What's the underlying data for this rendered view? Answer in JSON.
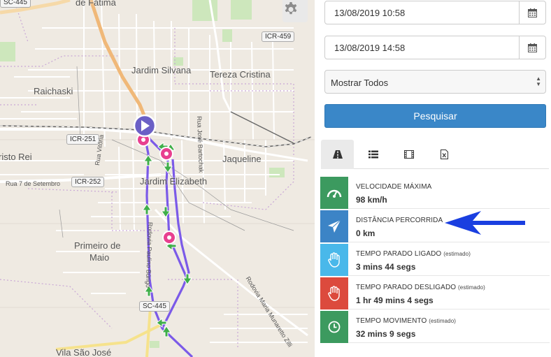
{
  "map": {
    "labels": {
      "fatima": "de Fátima",
      "jardim_silvana": "Jardim Silvana",
      "tereza_cristina": "Tereza Cristina",
      "raichaski": "Raichaski",
      "cristo_rei": "risto Rei",
      "jaqueline": "Jaqueline",
      "jardim_elizabeth": "Jardim Elizabeth",
      "primeiro_de_maio": "Primeiro de",
      "primeiro_de_maio_2": "Maio",
      "vila_sao_jose": "Vila São José"
    },
    "shields": {
      "sc445_top": "SC-445",
      "icr459": "ICR-459",
      "icr251": "ICR-251",
      "icr252": "ICR-252",
      "sc445_bottom": "SC-445"
    },
    "road_names": {
      "rua_7_setembro": "Rua 7 de Setembro",
      "rua_vitoria": "Rua Vitória",
      "rua_jose_bartochak": "Rua José Bartochak",
      "rodovia_paulino_burigo": "Rodovia Paulino Búrigo",
      "rodovia_maria_munaretto": "Rodovia Maria Munaretto Zilli"
    },
    "settings_icon": "gear-icon",
    "colors": {
      "route": "#7b5ae8",
      "marker": "#e8408f",
      "arrow": "#3fae49",
      "start": "#6b60c6"
    }
  },
  "filters": {
    "start_date": "13/08/2019 10:58",
    "end_date": "13/08/2019 14:58",
    "select_value": "Mostrar Todos",
    "search_label": "Pesquisar"
  },
  "tabs": [
    {
      "icon": "road-icon",
      "active": true
    },
    {
      "icon": "list-icon",
      "active": false
    },
    {
      "icon": "film-icon",
      "active": false
    },
    {
      "icon": "excel-icon",
      "active": false
    }
  ],
  "stats": [
    {
      "label": "VELOCIDADE MÁXIMA",
      "note": "",
      "value": "98 km/h",
      "color": "#3c9a5f",
      "icon": "speedometer-icon"
    },
    {
      "label": "DISTÂNCIA PERCORRIDA",
      "note": "",
      "value": "0 km",
      "color": "#3c84c6",
      "icon": "paper-plane-icon"
    },
    {
      "label": "TEMPO PARADO LIGADO",
      "note": "(estimado)",
      "value": "3 mins 44 segs",
      "color": "#49b8ea",
      "icon": "hand-icon"
    },
    {
      "label": "TEMPO PARADO DESLIGADO",
      "note": "(estimado)",
      "value": "1 hr 49 mins 4 segs",
      "color": "#dc4a3d",
      "icon": "hand-stop-icon"
    },
    {
      "label": "TEMPO MOVIMENTO",
      "note": "(estimado)",
      "value": "32 mins 9 segs",
      "color": "#3c9a5f",
      "icon": "clock-icon"
    }
  ],
  "annotation_arrow_color": "#1a3fe0"
}
